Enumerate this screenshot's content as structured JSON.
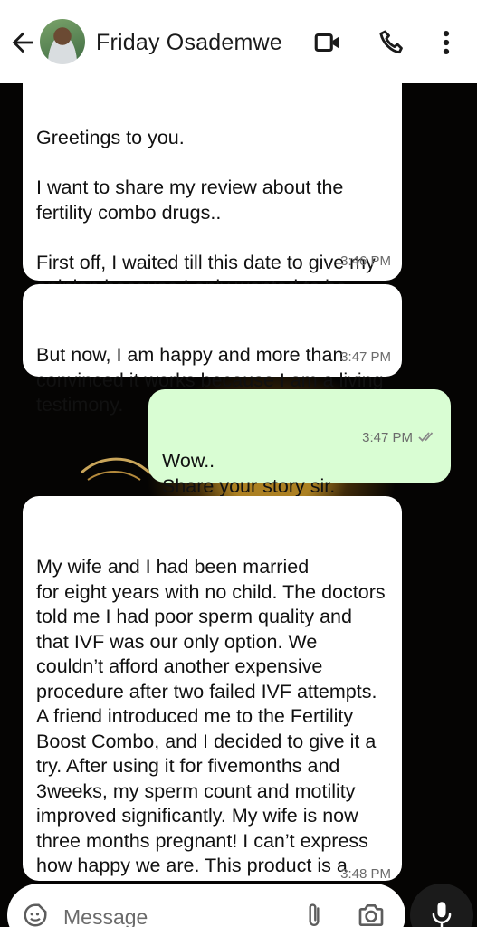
{
  "header": {
    "contact_name": "Friday Osademwe",
    "icons": [
      "back-arrow-icon",
      "video-call-icon",
      "phone-icon",
      "more-vertical-icon"
    ]
  },
  "messages": [
    {
      "direction": "incoming",
      "text": "Greetings to you.\n\nI want to share my review about the fertility combo drugs..\n\nFirst off, I waited till this date to give my opinion because I only wanted to be sure the combo works",
      "time": "3:46 PM"
    },
    {
      "direction": "incoming",
      "text": "But now, I am happy and more than convinced it works because I am a living testimony.",
      "time": "3:47 PM"
    },
    {
      "direction": "outgoing",
      "text": "Wow..\nShare your story sir.\nI would love to hear",
      "time": "3:47 PM",
      "status": "read"
    },
    {
      "direction": "incoming",
      "text": "My wife and I had been married\nfor eight years with no child. The doctors told me I had poor sperm quality and that IVF was our only option. We couldn’t afford another expensive procedure after two failed IVF attempts. A friend introduced me to the Fertility Boost Combo, and I decided to give it a try. After using it for fivemonths and 3weeks, my sperm count and motility improved significantly. My wife is now three months pregnant! I can’t express how happy we are. This product is a awesome!",
      "time": "3:48 PM"
    }
  ],
  "composer": {
    "placeholder": "Message",
    "icons": [
      "emoji-sticker-icon",
      "attach-icon",
      "camera-icon",
      "mic-icon"
    ]
  },
  "colors": {
    "incoming_bubble": "#ffffff",
    "outgoing_bubble": "#d9fdd3",
    "read_ticks": "#8a8a8a"
  }
}
